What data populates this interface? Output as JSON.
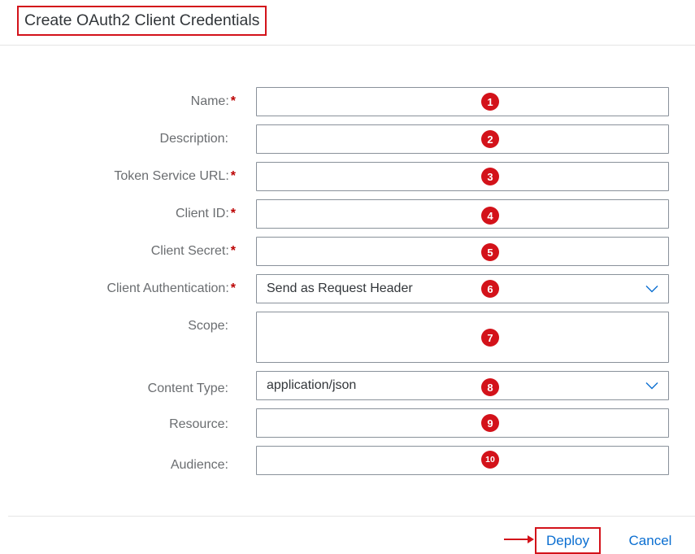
{
  "dialog": {
    "title": "Create OAuth2 Client Credentials"
  },
  "form": {
    "required_marker": "*",
    "fields": [
      {
        "label": "Name:",
        "required": true,
        "value": "",
        "badge": "1",
        "type": "text"
      },
      {
        "label": "Description:",
        "required": false,
        "value": "",
        "badge": "2",
        "type": "text"
      },
      {
        "label": "Token Service URL:",
        "required": true,
        "value": "",
        "badge": "3",
        "type": "text"
      },
      {
        "label": "Client ID:",
        "required": true,
        "value": "",
        "badge": "4",
        "type": "text"
      },
      {
        "label": "Client Secret:",
        "required": true,
        "value": "",
        "badge": "5",
        "type": "text"
      },
      {
        "label": "Client Authentication:",
        "required": true,
        "value": "Send as Request Header",
        "badge": "6",
        "type": "select"
      },
      {
        "label": "Scope:",
        "required": false,
        "value": "",
        "badge": "7",
        "type": "textarea"
      },
      {
        "label": "Content Type:",
        "required": false,
        "value": "application/json",
        "badge": "8",
        "type": "select"
      },
      {
        "label": "Resource:",
        "required": false,
        "value": "",
        "badge": "9",
        "type": "text"
      },
      {
        "label": "Audience:",
        "required": false,
        "value": "",
        "badge": "10",
        "type": "text"
      }
    ]
  },
  "footer": {
    "deploy_label": "Deploy",
    "cancel_label": "Cancel"
  },
  "colors": {
    "annotation_red": "#d3121a",
    "required_red": "#bb0000",
    "link_blue": "#0a6ed1",
    "label_grey": "#6a6d70",
    "input_border": "#89919a"
  }
}
